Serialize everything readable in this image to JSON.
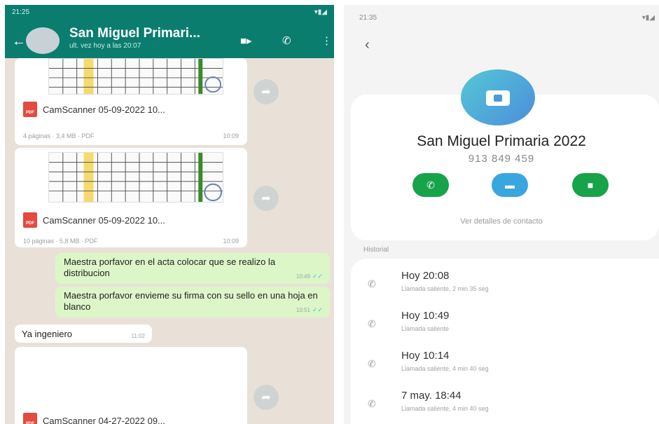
{
  "chat": {
    "status_time": "21:25",
    "title": "San Miguel Primari...",
    "subtitle": "ult. vez hoy a las 20:07",
    "messages": [
      {
        "type": "doc",
        "name": "CamScanner 05-09-2022 10...",
        "meta": "4 páginas · 3,4 MB · PDF",
        "time": "10:09"
      },
      {
        "type": "doc",
        "name": "CamScanner 05-09-2022 10...",
        "meta": "10 páginas · 5,8 MB · PDF",
        "time": "10:09"
      },
      {
        "type": "out",
        "text": "Maestra porfavor en el acta colocar que se realizo la distribucion",
        "time": "10:49"
      },
      {
        "type": "out",
        "text": "Maestra porfavor envieme su firma con su sello en una hoja en blanco",
        "time": "10:51"
      },
      {
        "type": "in",
        "text": "Ya ingeniero",
        "time": "11:02"
      },
      {
        "type": "doc",
        "name": "CamScanner 04-27-2022 09...",
        "meta": "",
        "time": ""
      }
    ]
  },
  "contact": {
    "status_time": "21:35",
    "name": "San Miguel Primaria 2022",
    "phone": "913 849 459",
    "details_link": "Ver detalles de contacto",
    "history_label": "Historial",
    "history": [
      {
        "time": "Hoy 20:08",
        "detail": "Llamada saliente, 2 min 35 seg"
      },
      {
        "time": "Hoy 10:49",
        "detail": "Llamada saliente"
      },
      {
        "time": "Hoy 10:14",
        "detail": "Llamada saliente, 4 min 40 seg"
      },
      {
        "time": "7 may. 18:44",
        "detail": "Llamada saliente, 4 min 40 seg"
      }
    ]
  },
  "colors": {
    "wa_header": "#0b7d6f",
    "chat_bg": "#e9e1d8",
    "outgoing_bubble": "#dcf6c8",
    "call_green": "#16a34a",
    "message_blue": "#3aa6e0"
  }
}
